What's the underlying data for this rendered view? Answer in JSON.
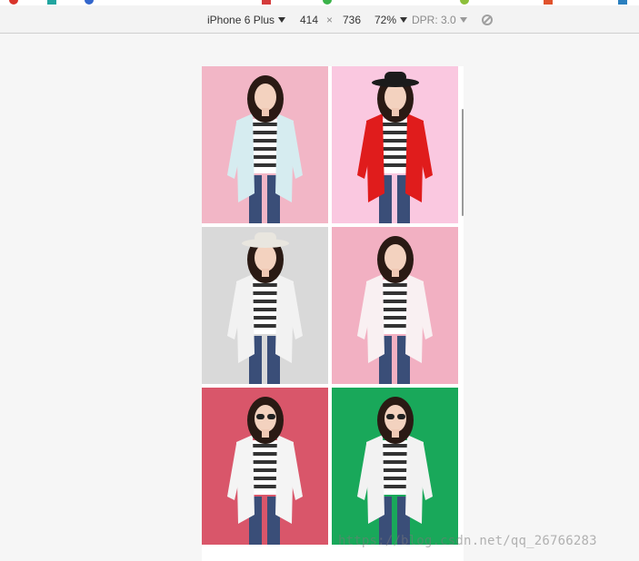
{
  "device_toolbar": {
    "device": "iPhone 6 Plus",
    "width": "414",
    "times": "×",
    "height": "736",
    "zoom": "72%",
    "dpr": "DPR: 3.0"
  },
  "gallery": {
    "tiles": [
      {
        "name": "photo-woman-light-blue-blazer",
        "bg": "#f2b6c6",
        "coat": "#d6ecf0"
      },
      {
        "name": "photo-woman-red-blazer-hat",
        "bg": "#fac8e0",
        "coat": "#e01c1c"
      },
      {
        "name": "photo-woman-white-blazer-hat",
        "bg": "#d9d9d9",
        "coat": "#f2f2f2"
      },
      {
        "name": "photo-woman-white-blazer-pink",
        "bg": "#f2b0c2",
        "coat": "#f9f0f2"
      },
      {
        "name": "photo-woman-pink-skirt-street",
        "bg": "#d9566a",
        "coat": "#f4f4f4"
      },
      {
        "name": "photo-woman-megaphone-green",
        "bg": "#19a85a",
        "coat": "#f2f2f2"
      }
    ]
  },
  "watermark": "https://blog.csdn.net/qq_26766283",
  "colors": {
    "toolbar_bg": "#f3f3f3",
    "page_bg": "#f6f6f6",
    "watermark": "#9a9a9a"
  }
}
